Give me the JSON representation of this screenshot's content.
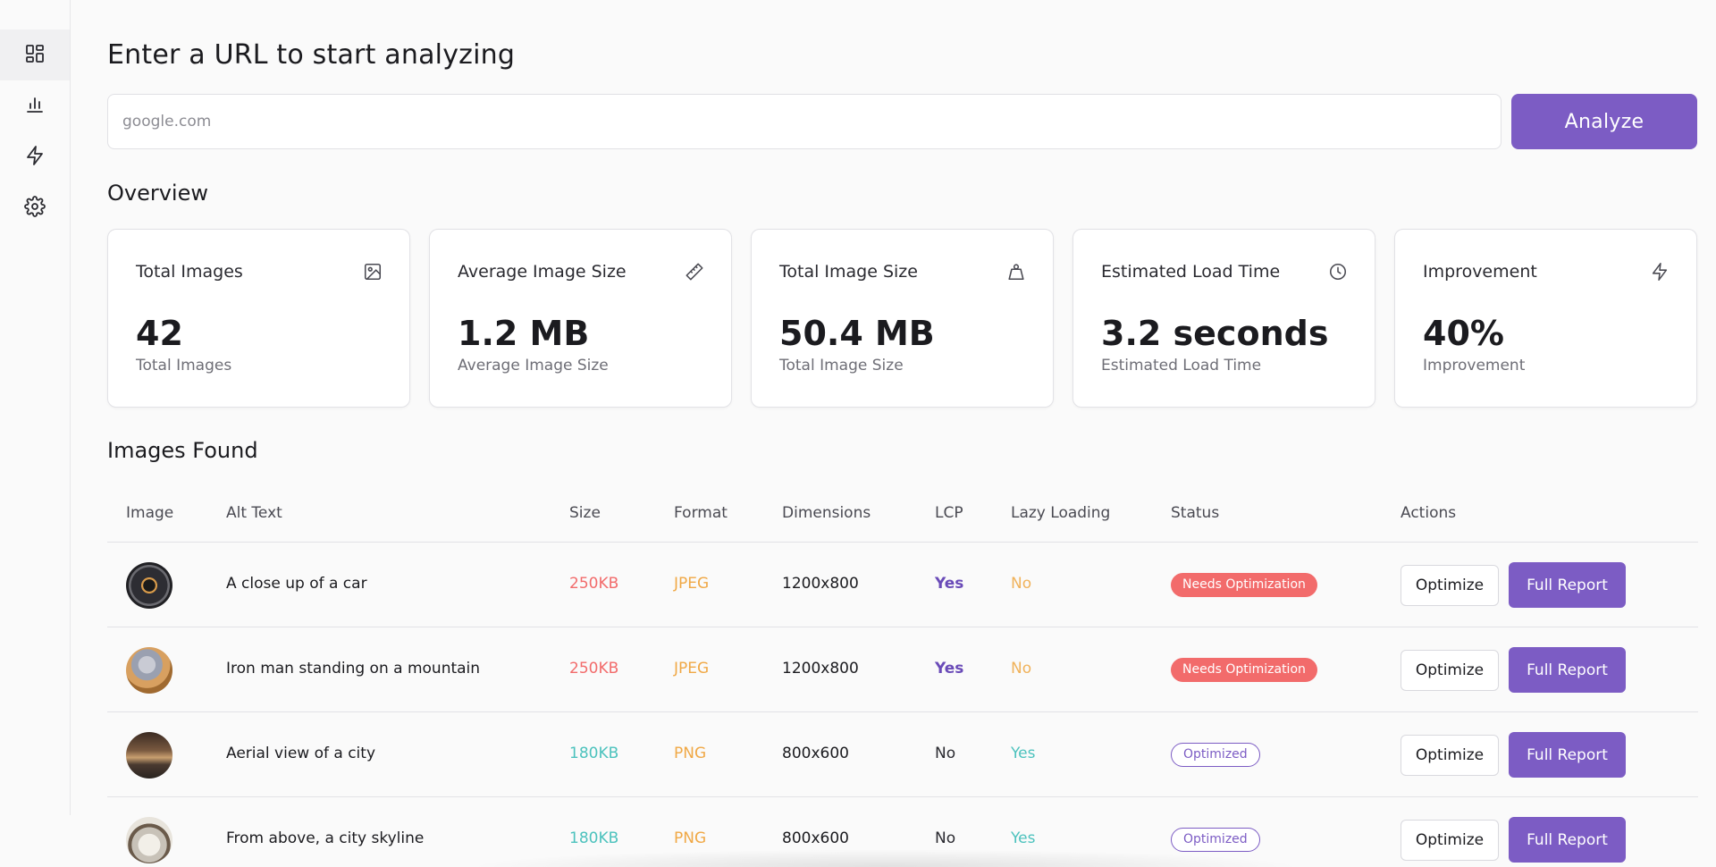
{
  "sidebar": {
    "items": [
      {
        "icon": "dashboard-icon",
        "active": true
      },
      {
        "icon": "bar-chart-icon",
        "active": false
      },
      {
        "icon": "lightning-icon",
        "active": false
      },
      {
        "icon": "gear-icon",
        "active": false
      }
    ]
  },
  "analyze": {
    "heading": "Enter a URL to start analyzing",
    "placeholder": "google.com",
    "value": "",
    "button_label": "Analyze"
  },
  "overview": {
    "heading": "Overview",
    "cards": [
      {
        "title": "Total Images",
        "icon": "image-icon",
        "value": "42",
        "sub": "Total Images"
      },
      {
        "title": "Average Image Size",
        "icon": "ruler-icon",
        "value": "1.2 MB",
        "sub": "Average Image Size"
      },
      {
        "title": "Total Image Size",
        "icon": "weight-icon",
        "value": "50.4 MB",
        "sub": "Total Image Size"
      },
      {
        "title": "Estimated Load Time",
        "icon": "clock-icon",
        "value": "3.2 seconds",
        "sub": "Estimated Load Time"
      },
      {
        "title": "Improvement",
        "icon": "lightning-icon",
        "value": "40%",
        "sub": "Improvement"
      }
    ]
  },
  "images": {
    "heading": "Images Found",
    "columns": [
      "Image",
      "Alt Text",
      "Size",
      "Format",
      "Dimensions",
      "LCP",
      "Lazy Loading",
      "Status",
      "Actions"
    ],
    "rows": [
      {
        "alt": "A close up of a car",
        "size": "250KB",
        "format": "JPEG",
        "dimensions": "1200x800",
        "lcp": "Yes",
        "lazy": "No",
        "status": "Needs Optimization",
        "optimize": "Optimize",
        "report": "Full Report"
      },
      {
        "alt": "Iron man standing on a mountain",
        "size": "250KB",
        "format": "JPEG",
        "dimensions": "1200x800",
        "lcp": "Yes",
        "lazy": "No",
        "status": "Needs Optimization",
        "optimize": "Optimize",
        "report": "Full Report"
      },
      {
        "alt": "Aerial view of a city",
        "size": "180KB",
        "format": "PNG",
        "dimensions": "800x600",
        "lcp": "No",
        "lazy": "Yes",
        "status": "Optimized",
        "optimize": "Optimize",
        "report": "Full Report"
      },
      {
        "alt": "From above, a city skyline",
        "size": "180KB",
        "format": "PNG",
        "dimensions": "800x600",
        "lcp": "No",
        "lazy": "Yes",
        "status": "Optimized",
        "optimize": "Optimize",
        "report": "Full Report"
      }
    ]
  },
  "colors": {
    "accent": "#7c5cc4",
    "danger": "#f26b6b",
    "warning": "#f0a845",
    "teal": "#4cc2bd"
  }
}
